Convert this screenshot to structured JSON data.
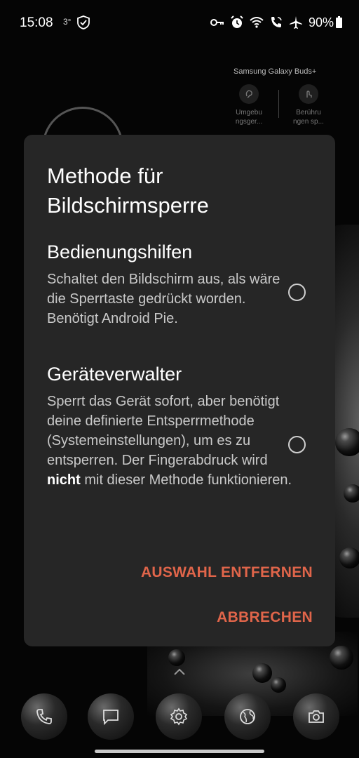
{
  "status_bar": {
    "time": "15:08",
    "temperature": "3°",
    "battery": "90%",
    "icons": [
      "shield-icon",
      "key-icon",
      "alarm-icon",
      "wifi-icon",
      "wifi-calling-icon",
      "airplane-icon",
      "battery-icon"
    ]
  },
  "widget": {
    "title": "Samsung Galaxy Buds+",
    "left_label": "Umgebu ngsger...",
    "right_label": "Berühru ngen sp..."
  },
  "dialog": {
    "title": "Methode für Bildschirmsperre",
    "options": [
      {
        "title": "Bedienungshilfen",
        "description": "Schaltet den Bildschirm aus, als wäre die Sperrtaste gedrückt worden. Benötigt Android Pie.",
        "selected": false
      },
      {
        "title": "Geräteverwalter",
        "description_before": "Sperrt das Gerät sofort, aber benötigt deine definierte Entsperrmethode (Systemeinstellungen), um es zu entsperren. Der Fingerabdruck wird ",
        "description_bold": "nicht",
        "description_after": " mit dieser Methode funktionieren.",
        "selected": false
      }
    ],
    "clear_button": "AUSWAHL ENTFERNEN",
    "cancel_button": "ABBRECHEN"
  },
  "dock": {
    "icons": [
      "phone-icon",
      "messages-icon",
      "settings-icon",
      "browser-icon",
      "camera-icon"
    ]
  },
  "colors": {
    "accent": "#e0654a",
    "dialog_bg": "#262626",
    "background": "#050505"
  }
}
